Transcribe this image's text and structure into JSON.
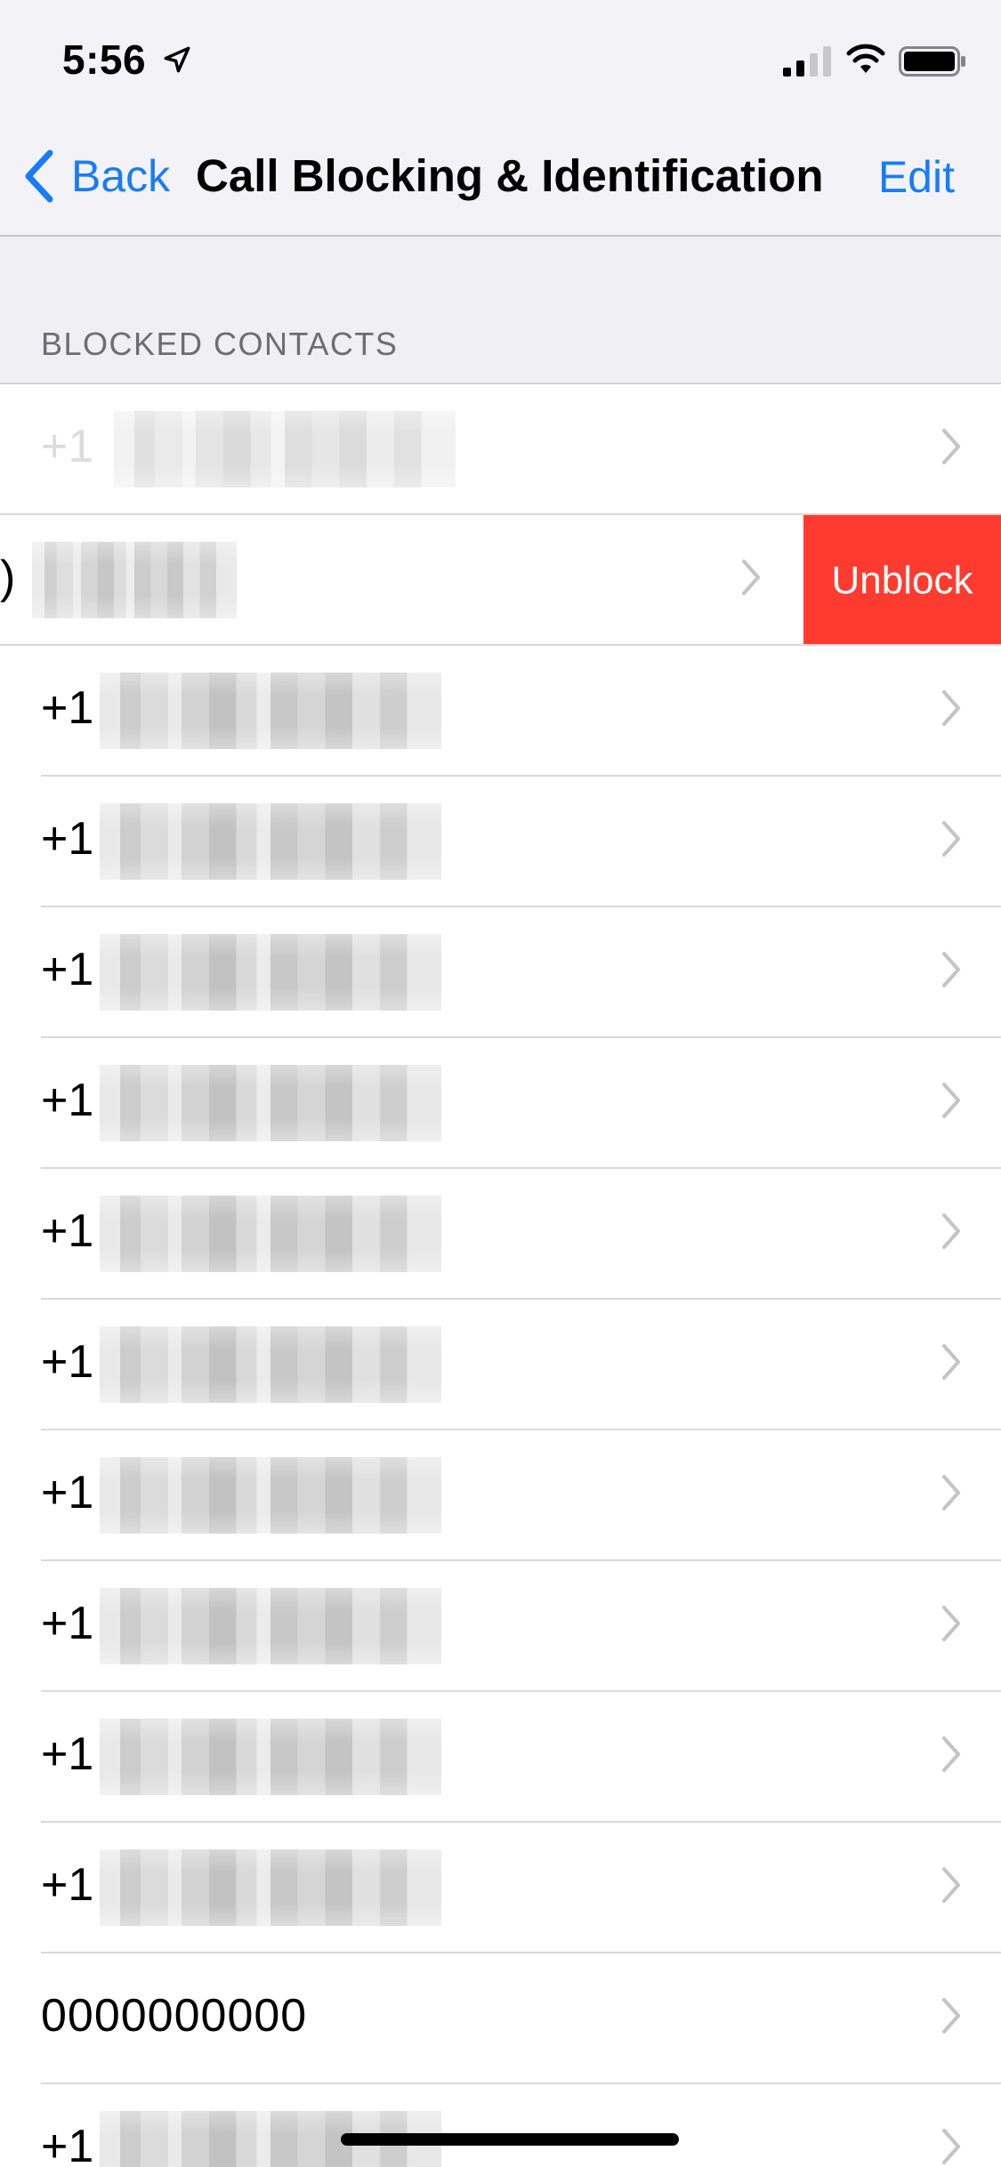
{
  "status_bar": {
    "time": "5:56"
  },
  "nav": {
    "back_label": "Back",
    "title": "Call Blocking & Identification",
    "edit_label": "Edit"
  },
  "section": {
    "header": "BLOCKED CONTACTS"
  },
  "swipe_action": {
    "label": "Unblock",
    "color": "#ff3b30"
  },
  "rows": [
    {
      "prefix": "+1",
      "redacted": true
    },
    {
      "prefix": ")",
      "redacted": true,
      "swiped": true
    },
    {
      "prefix": "+1",
      "redacted": true
    },
    {
      "prefix": "+1",
      "redacted": true
    },
    {
      "prefix": "+1",
      "redacted": true
    },
    {
      "prefix": "+1",
      "redacted": true
    },
    {
      "prefix": "+1",
      "redacted": true
    },
    {
      "prefix": "+1",
      "redacted": true
    },
    {
      "prefix": "+1",
      "redacted": true
    },
    {
      "prefix": "+1",
      "redacted": true
    },
    {
      "prefix": "+1",
      "redacted": true
    },
    {
      "prefix": "+1",
      "redacted": true
    },
    {
      "prefix": "0000000000",
      "redacted": false
    },
    {
      "prefix": "+1",
      "redacted": true
    }
  ],
  "colors": {
    "accent": "#1a7cf5",
    "destructive": "#ff3b30"
  }
}
